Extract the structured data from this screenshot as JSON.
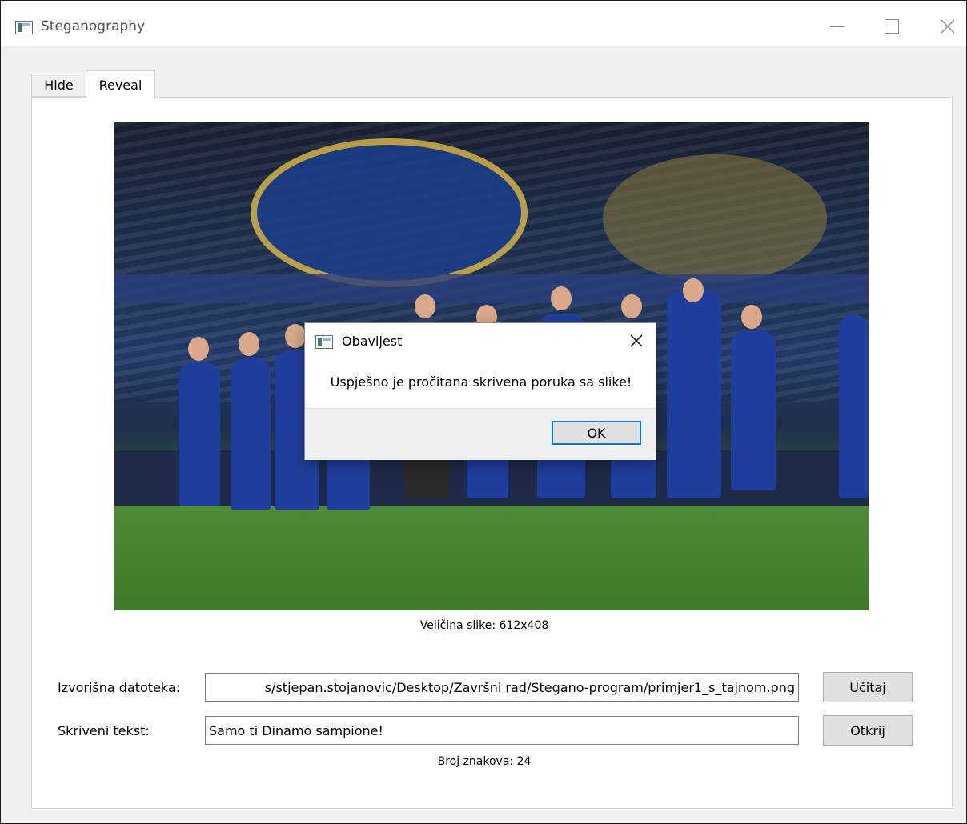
{
  "window": {
    "title": "Steganography",
    "icons": {
      "app": "app-icon",
      "minimize": "minimize-icon",
      "maximize": "maximize-icon",
      "close": "close-icon"
    }
  },
  "tabs": [
    {
      "label": "Hide",
      "active": false
    },
    {
      "label": "Reveal",
      "active": true
    }
  ],
  "image": {
    "description_icon": "football-team-photo",
    "size_label": "Veličina slike: 612x408"
  },
  "form": {
    "source_label": "Izvorišna datoteka:",
    "source_value": "s/stjepan.stojanovic/Desktop/Završni rad/Stegano-program/primjer1_s_tajnom.png",
    "load_button": "Učitaj",
    "hidden_label": "Skriveni tekst:",
    "hidden_value": "Samo ti Dinamo sampione!",
    "reveal_button": "Otkrij",
    "char_count": "Broj znakova: 24"
  },
  "dialog": {
    "title": "Obavijest",
    "message": "Uspješno je pročitana skrivena poruka sa slike!",
    "ok_button": "OK"
  }
}
